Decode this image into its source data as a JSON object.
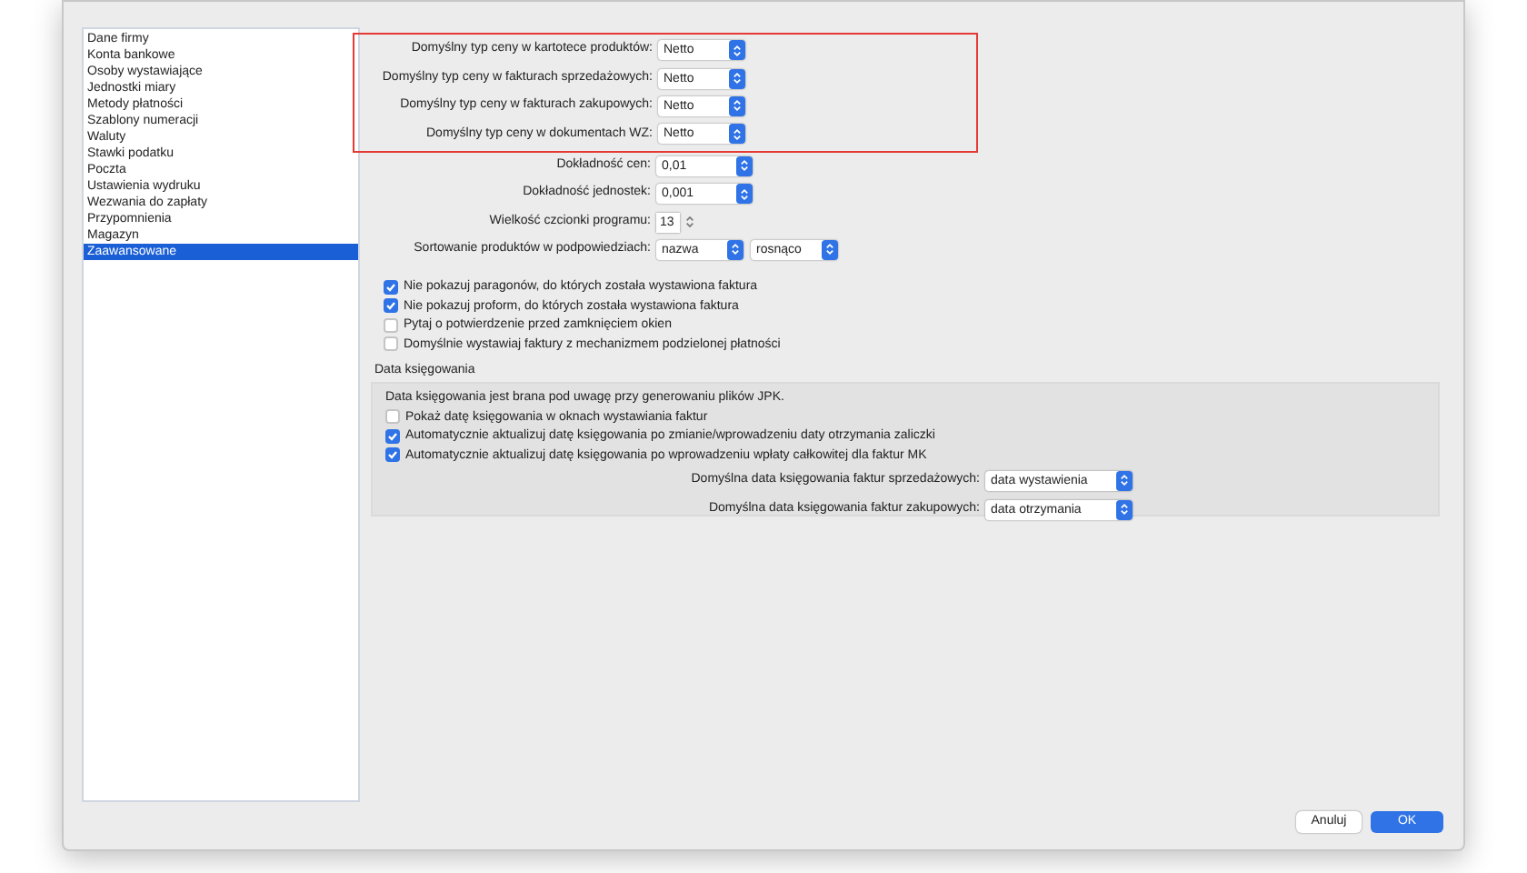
{
  "sidebar": {
    "items": [
      {
        "label": "Dane firmy",
        "selected": false
      },
      {
        "label": "Konta bankowe",
        "selected": false
      },
      {
        "label": "Osoby wystawiające",
        "selected": false
      },
      {
        "label": "Jednostki miary",
        "selected": false
      },
      {
        "label": "Metody płatności",
        "selected": false
      },
      {
        "label": "Szablony numeracji",
        "selected": false
      },
      {
        "label": "Waluty",
        "selected": false
      },
      {
        "label": "Stawki podatku",
        "selected": false
      },
      {
        "label": "Poczta",
        "selected": false
      },
      {
        "label": "Ustawienia wydruku",
        "selected": false
      },
      {
        "label": "Wezwania do zapłaty",
        "selected": false
      },
      {
        "label": "Przypomnienia",
        "selected": false
      },
      {
        "label": "Magazyn",
        "selected": false
      },
      {
        "label": "Zaawansowane",
        "selected": true
      }
    ]
  },
  "settings": [
    {
      "label": "Domyślny typ ceny w kartotece produktów:",
      "highlighted": true,
      "controls": [
        {
          "kind": "popup",
          "value": "Netto"
        }
      ]
    },
    {
      "label": "Domyślny typ ceny w fakturach sprzedażowych:",
      "highlighted": true,
      "controls": [
        {
          "kind": "popup",
          "value": "Netto"
        }
      ]
    },
    {
      "label": "Domyślny typ ceny w fakturach zakupowych:",
      "highlighted": true,
      "controls": [
        {
          "kind": "popup",
          "value": "Netto"
        }
      ]
    },
    {
      "label": "Domyślny typ ceny w dokumentach WZ:",
      "highlighted": true,
      "controls": [
        {
          "kind": "popup",
          "value": "Netto"
        }
      ]
    },
    {
      "label": "Dokładność cen:",
      "highlighted": false,
      "controls": [
        {
          "kind": "combo",
          "value": "0,01"
        }
      ]
    },
    {
      "label": "Dokładność jednostek:",
      "highlighted": false,
      "controls": [
        {
          "kind": "combo",
          "value": "0,001"
        }
      ]
    },
    {
      "label": "Wielkość czcionki programu:",
      "highlighted": false,
      "controls": [
        {
          "kind": "stepper",
          "value": "13"
        }
      ]
    },
    {
      "label": "Sortowanie produktów w podpowiedziach:",
      "highlighted": false,
      "controls": [
        {
          "kind": "popup",
          "value": "nazwa"
        },
        {
          "kind": "popup",
          "value": "rosnąco"
        }
      ]
    }
  ],
  "options": [
    {
      "label": "Nie pokazuj paragonów, do których została wystawiona faktura",
      "checked": true
    },
    {
      "label": "Nie pokazuj proform, do których została wystawiona faktura",
      "checked": true
    },
    {
      "label": "Pytaj o potwierdzenie przed zamknięciem okien",
      "checked": false
    },
    {
      "label": "Domyślnie wystawiaj faktury z mechanizmem podzielonej płatności",
      "checked": false
    }
  ],
  "posting_date": {
    "title": "Data księgowania",
    "note": "Data księgowania jest brana pod uwagę przy generowaniu plików JPK.",
    "options": [
      {
        "label": "Pokaż datę księgowania w oknach wystawiania faktur",
        "checked": false
      },
      {
        "label": "Automatycznie aktualizuj datę księgowania po zmianie/wprowadzeniu daty otrzymania zaliczki",
        "checked": true
      },
      {
        "label": "Automatycznie aktualizuj datę księgowania po wprowadzeniu wpłaty całkowitej dla faktur MK",
        "checked": true
      }
    ],
    "defaults": [
      {
        "label": "Domyślna data księgowania faktur sprzedażowych:",
        "value": "data wystawienia"
      },
      {
        "label": "Domyślna data księgowania faktur zakupowych:",
        "value": "data otrzymania"
      }
    ]
  },
  "buttons": [
    {
      "label": "Anuluj",
      "default": false
    },
    {
      "label": "OK",
      "default": true
    }
  ]
}
